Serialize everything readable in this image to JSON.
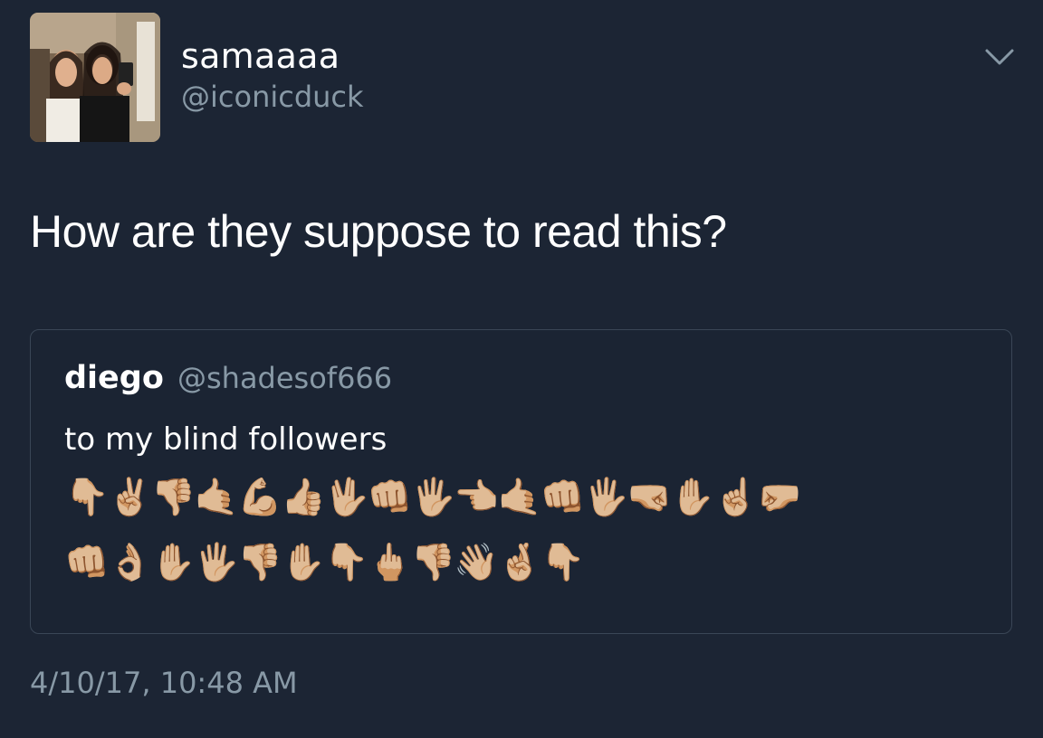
{
  "author": {
    "display_name": "samaaaa",
    "handle": "@iconicduck"
  },
  "tweet": {
    "text": "How are they suppose to read this?",
    "timestamp": "4/10/17, 10:48 AM"
  },
  "icons": {
    "menu": "chevron-down-icon",
    "avatar": "profile-photo"
  },
  "quoted_tweet": {
    "display_name": "diego",
    "handle": "@shadesof666",
    "text": "to my blind followers",
    "emoji_line_1": "👇🏼✌🏼👎🏼🤙🏼💪🏼👍🏼🖖🏼👊🏼🖐🏼👈🏼🤙🏼👊🏼🖐🏼🤜🏼✋🏼☝🏼🤛🏼",
    "emoji_line_2": "👊🏼👌🏼✋🏼🖐🏼👎🏼✋🏼👇🏼🖕🏼👎🏼👋🏼🤞🏼👇🏼"
  },
  "colors": {
    "background": "#1c2534",
    "primary_text": "#ffffff",
    "secondary_text": "#8899a6",
    "quote_border": "#3a4656"
  }
}
